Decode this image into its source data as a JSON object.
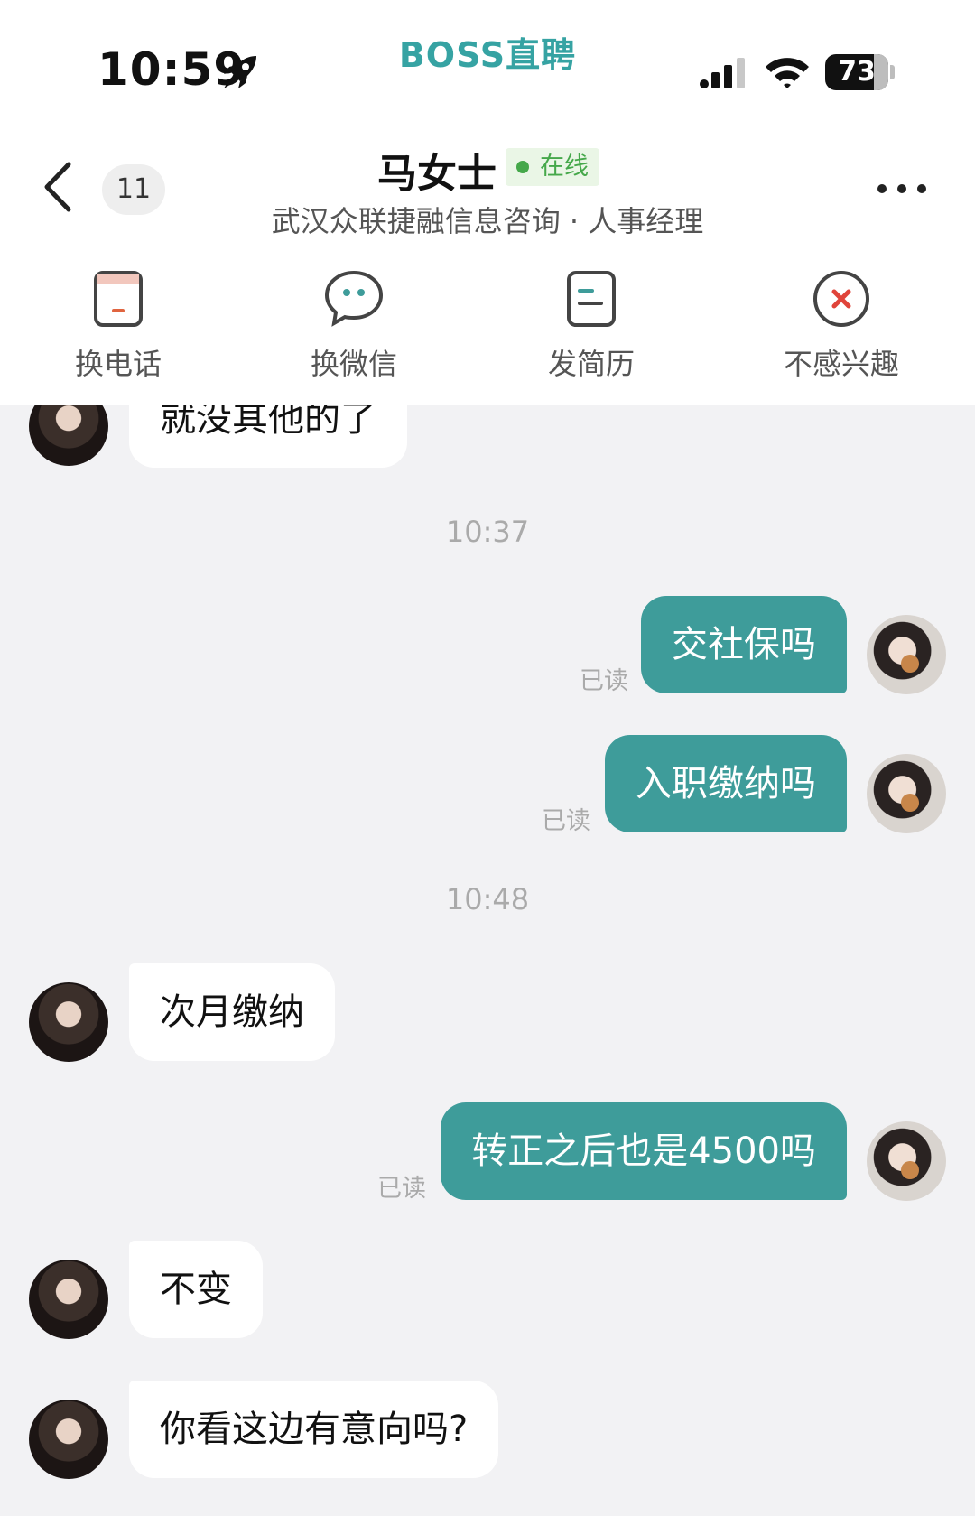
{
  "status_bar": {
    "time": "10:59",
    "battery": "73",
    "icons": [
      "rocket-icon",
      "signal-icon",
      "wifi-icon",
      "battery-icon"
    ]
  },
  "brand": "BOSS直聘",
  "nav": {
    "unread_count": "11",
    "contact_name": "马女士",
    "status": "在线",
    "subtitle": "武汉众联捷融信息咨询 · 人事经理",
    "accent_color": "#3e9c9a",
    "online_color": "#45a84a"
  },
  "actions": [
    {
      "label": "换电话",
      "icon": "phone-card-icon"
    },
    {
      "label": "换微信",
      "icon": "wechat-bubble-icon"
    },
    {
      "label": "发简历",
      "icon": "resume-icon"
    },
    {
      "label": "不感兴趣",
      "icon": "not-interested-icon"
    }
  ],
  "messages": [
    {
      "side": "left",
      "text": "就没其他的了"
    },
    {
      "type": "timestamp",
      "text": "10:37"
    },
    {
      "side": "right",
      "text": "交社保吗",
      "status": "已读"
    },
    {
      "side": "right",
      "text": "入职缴纳吗",
      "status": "已读"
    },
    {
      "type": "timestamp",
      "text": "10:48"
    },
    {
      "side": "left",
      "text": "次月缴纳"
    },
    {
      "side": "right",
      "text": "转正之后也是4500吗",
      "status": "已读"
    },
    {
      "side": "left",
      "text": "不变"
    },
    {
      "side": "left",
      "text": "你看这边有意向吗?"
    }
  ]
}
